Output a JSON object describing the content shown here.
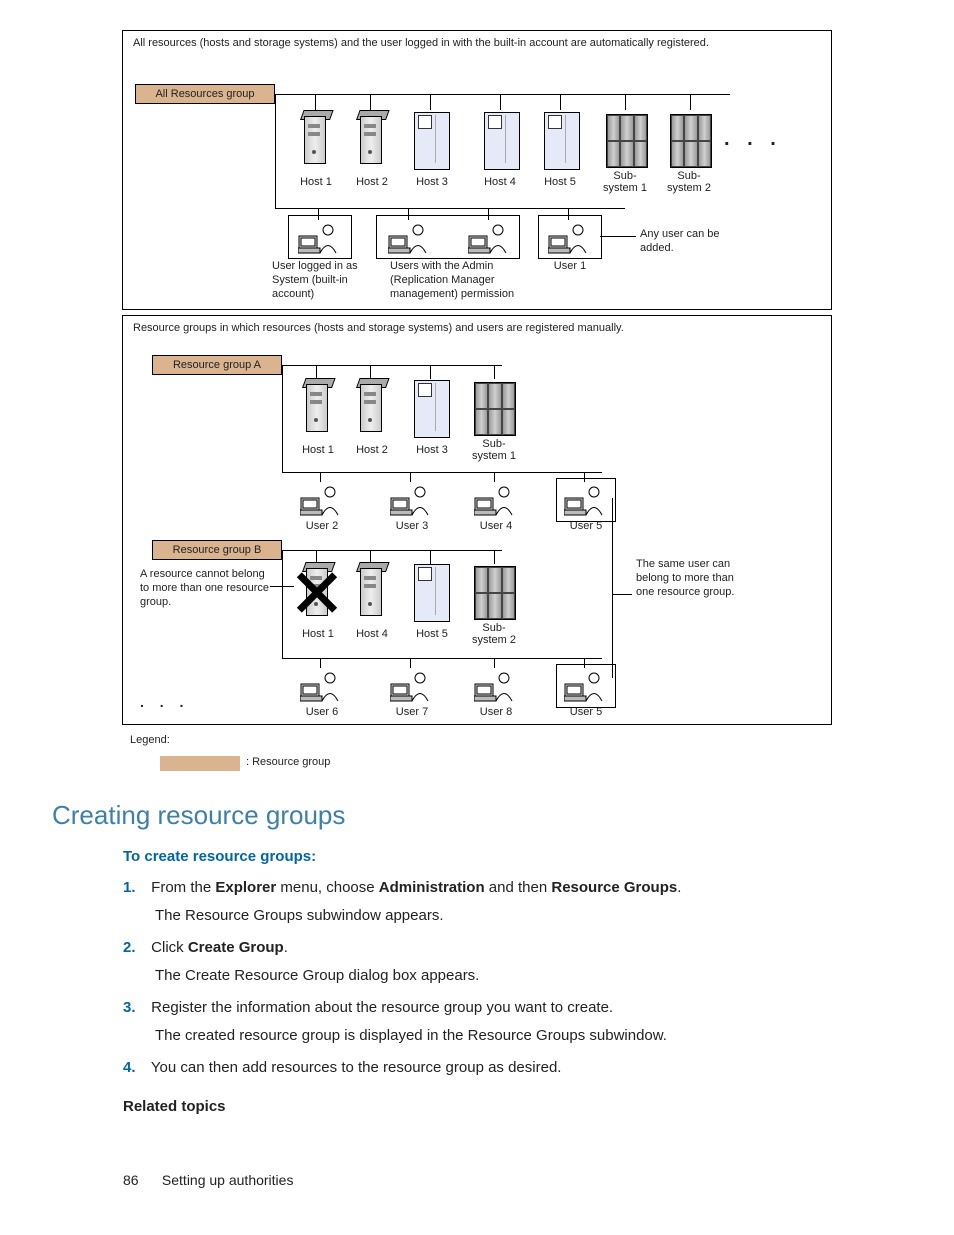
{
  "diagram": {
    "panel1_text": "All resources (hosts and storage systems) and the user logged in with the built-in account are automatically registered.",
    "panel2_text": "Resource groups in which resources (hosts and storage systems) and users are registered manually.",
    "group_all": "All Resources group",
    "group_a": "Resource group A",
    "group_b": "Resource group B",
    "hosts": {
      "h1": "Host 1",
      "h2": "Host 2",
      "h3": "Host 3",
      "h4": "Host 4",
      "h5": "Host 5"
    },
    "subsystems": {
      "s1": "Sub-\nsystem 1",
      "s2": "Sub-\nsystem 2",
      "s1_flat": "Sub-system 1",
      "s2_flat": "Sub-system 2"
    },
    "users": {
      "u1": "User 1",
      "u2": "User 2",
      "u3": "User 3",
      "u4": "User 4",
      "u5": "User 5",
      "u6": "User 6",
      "u7": "User 7",
      "u8": "User 8"
    },
    "captions": {
      "login_system": "User logged in as System (built-in account)",
      "admin_users": "Users with the Admin (Replication Manager management) permission",
      "any_user": "Any user can be added.",
      "cannot_belong": "A resource cannot belong to more than one resource group.",
      "same_user": "The same user can belong to more than one resource group."
    },
    "ellipsis": ". . .",
    "legend_label": "Legend:",
    "legend_text": ": Resource group"
  },
  "content": {
    "heading": "Creating resource groups",
    "subheading": "To create resource groups:",
    "step1_num": "1.",
    "step1_a": "From the ",
    "step1_b": "Explorer",
    "step1_c": " menu, choose ",
    "step1_d": "Administration",
    "step1_e": " and then ",
    "step1_f": "Resource Groups",
    "step1_g": ".",
    "step1_sub": "The Resource Groups subwindow appears.",
    "step2_num": "2.",
    "step2_a": "Click ",
    "step2_b": "Create Group",
    "step2_c": ".",
    "step2_sub": "The Create Resource Group dialog box appears.",
    "step3_num": "3.",
    "step3_a": "Register the information about the resource group you want to create.",
    "step3_sub": "The created resource group is displayed in the Resource Groups subwindow.",
    "step4_num": "4.",
    "step4_a": "You can then add resources to the resource group as desired.",
    "related": "Related topics"
  },
  "footer": {
    "page": "86",
    "section": "Setting up authorities"
  }
}
